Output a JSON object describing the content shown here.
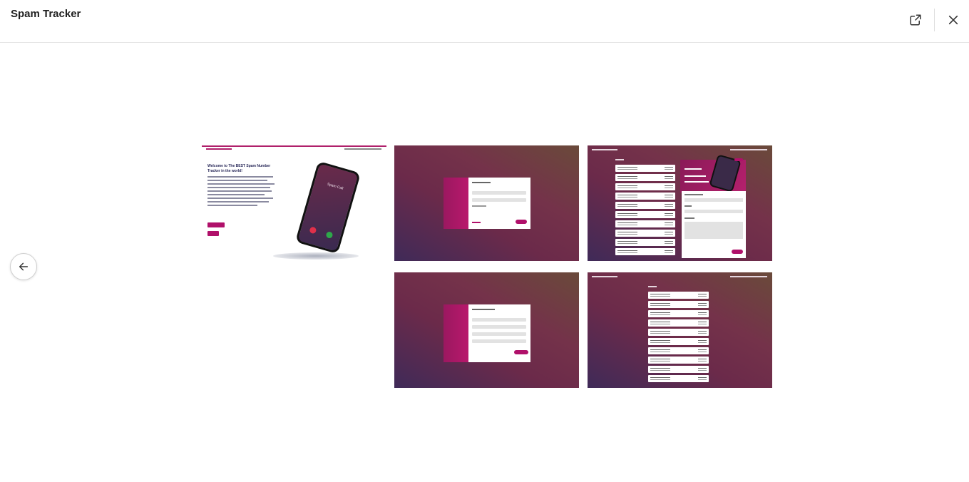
{
  "header": {
    "title": "Spam Tracker"
  },
  "icons": {
    "open": "external-link-icon",
    "close": "close-icon",
    "back": "arrow-left-icon"
  },
  "gallery": {
    "landing": {
      "headline": "Welcome to The BEST Spam Number Tracker in the world!",
      "phone_label": "Spam Call"
    }
  },
  "colors": {
    "accent": "#b0106a",
    "divider": "#e3e3e3"
  }
}
